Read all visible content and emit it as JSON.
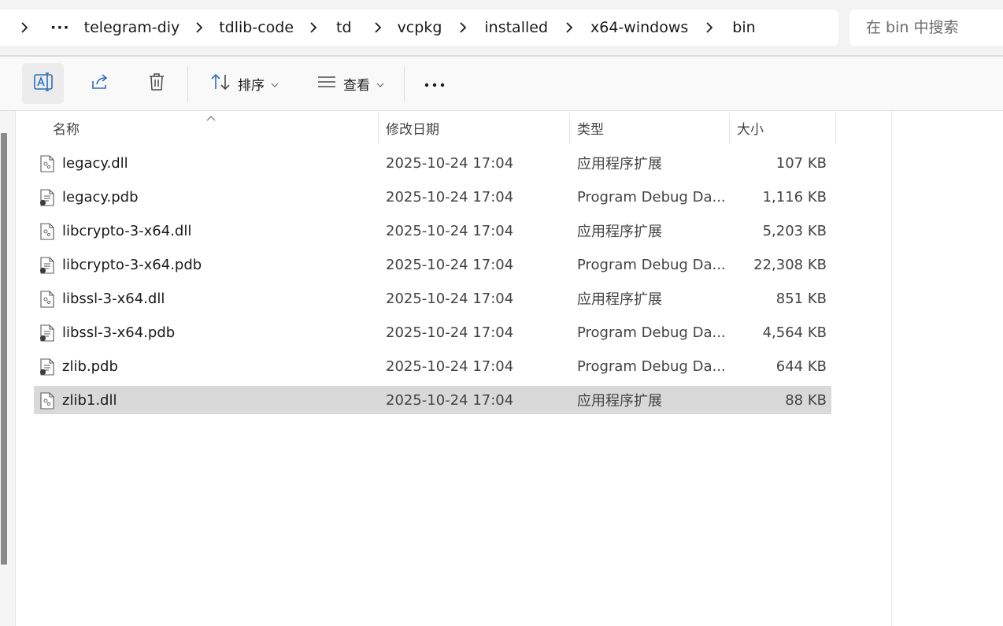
{
  "breadcrumb": {
    "overflow": "···",
    "items": [
      "telegram-diy",
      "tdlib-code",
      "td",
      "vcpkg",
      "installed",
      "x64-windows",
      "bin"
    ]
  },
  "search": {
    "placeholder": "在 bin 中搜索"
  },
  "toolbar": {
    "sort_label": "排序",
    "view_label": "查看"
  },
  "columns": {
    "name": "名称",
    "date": "修改日期",
    "type": "类型",
    "size": "大小"
  },
  "files": [
    {
      "name": "legacy.dll",
      "date": "2025-10-24 17:04",
      "type": "应用程序扩展",
      "size": "107 KB",
      "icon": "dll-file-icon"
    },
    {
      "name": "legacy.pdb",
      "date": "2025-10-24 17:04",
      "type": "Program Debug Da...",
      "size": "1,116 KB",
      "icon": "pdb-file-icon"
    },
    {
      "name": "libcrypto-3-x64.dll",
      "date": "2025-10-24 17:04",
      "type": "应用程序扩展",
      "size": "5,203 KB",
      "icon": "dll-file-icon"
    },
    {
      "name": "libcrypto-3-x64.pdb",
      "date": "2025-10-24 17:04",
      "type": "Program Debug Da...",
      "size": "22,308 KB",
      "icon": "pdb-file-icon"
    },
    {
      "name": "libssl-3-x64.dll",
      "date": "2025-10-24 17:04",
      "type": "应用程序扩展",
      "size": "851 KB",
      "icon": "dll-file-icon"
    },
    {
      "name": "libssl-3-x64.pdb",
      "date": "2025-10-24 17:04",
      "type": "Program Debug Da...",
      "size": "4,564 KB",
      "icon": "pdb-file-icon"
    },
    {
      "name": "zlib.pdb",
      "date": "2025-10-24 17:04",
      "type": "Program Debug Da...",
      "size": "644 KB",
      "icon": "pdb-file-icon"
    },
    {
      "name": "zlib1.dll",
      "date": "2025-10-24 17:04",
      "type": "应用程序扩展",
      "size": "88 KB",
      "icon": "dll-file-icon",
      "selected": true
    }
  ]
}
